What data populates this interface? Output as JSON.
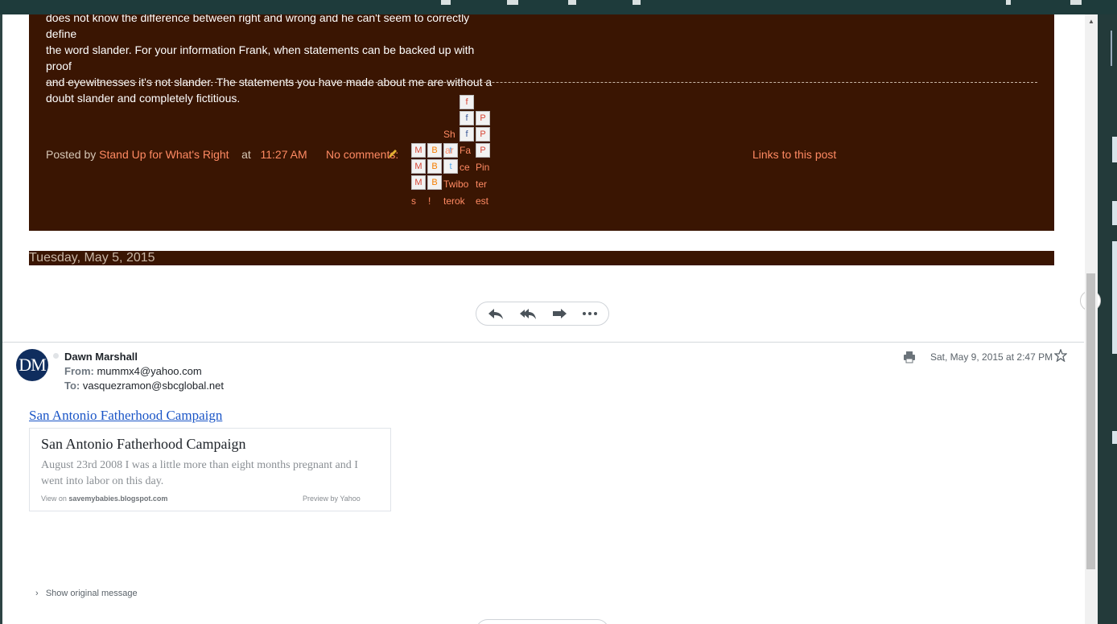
{
  "blog": {
    "post_lines": [
      "does not know the difference between right and wrong and he can't seem to correctly define",
      "the word slander. For your information Frank, when statements can be backed up with proof",
      "and eyewitnesses it's not slander. The statements you have made about me are without a",
      "doubt slander and completely fictitious."
    ],
    "posted_by_label": "Posted by",
    "author": "Stand Up for What's Right",
    "at_label": "at",
    "time": "11:27 AM",
    "comments": "No comments:",
    "links_to_post": "Links to this post",
    "share_labels": [
      "s",
      "!",
      "Twibo",
      "terok",
      "Fa",
      "ce",
      "Pin",
      "ter",
      "est",
      "Sh",
      "ar"
    ],
    "date_header": "Tuesday, May 5, 2015"
  },
  "email": {
    "avatar_initials": "DM",
    "sender_name": "Dawn Marshall",
    "from_label": "From:",
    "from_address": "mummx4@yahoo.com",
    "to_label": "To:",
    "to_address": "vasquezramon@sbcglobal.net",
    "date": "Sat, May 9, 2015 at 2:47 PM",
    "link_text": "San Antonio Fatherhood Campaign",
    "card": {
      "title": "San Antonio Fatherhood Campaign",
      "description": "August 23rd 2008 I was a little more than eight months pregnant and I went into labor on this day.",
      "view_on_label": "View on",
      "view_on_site": "savemybabies.blogspot.com",
      "preview_by": "Preview by Yahoo"
    },
    "show_original": "Show original message"
  },
  "colors": {
    "blog_bg": "#3a1502",
    "link_orange": "#ff8a63",
    "avatar_bg": "#0f2d5e",
    "link_blue": "#1a55c7"
  },
  "icons": [
    "reply-icon",
    "reply-all-icon",
    "forward-icon",
    "more-icon",
    "print-icon",
    "star-icon",
    "chevron-right-icon",
    "pencil-icon"
  ]
}
